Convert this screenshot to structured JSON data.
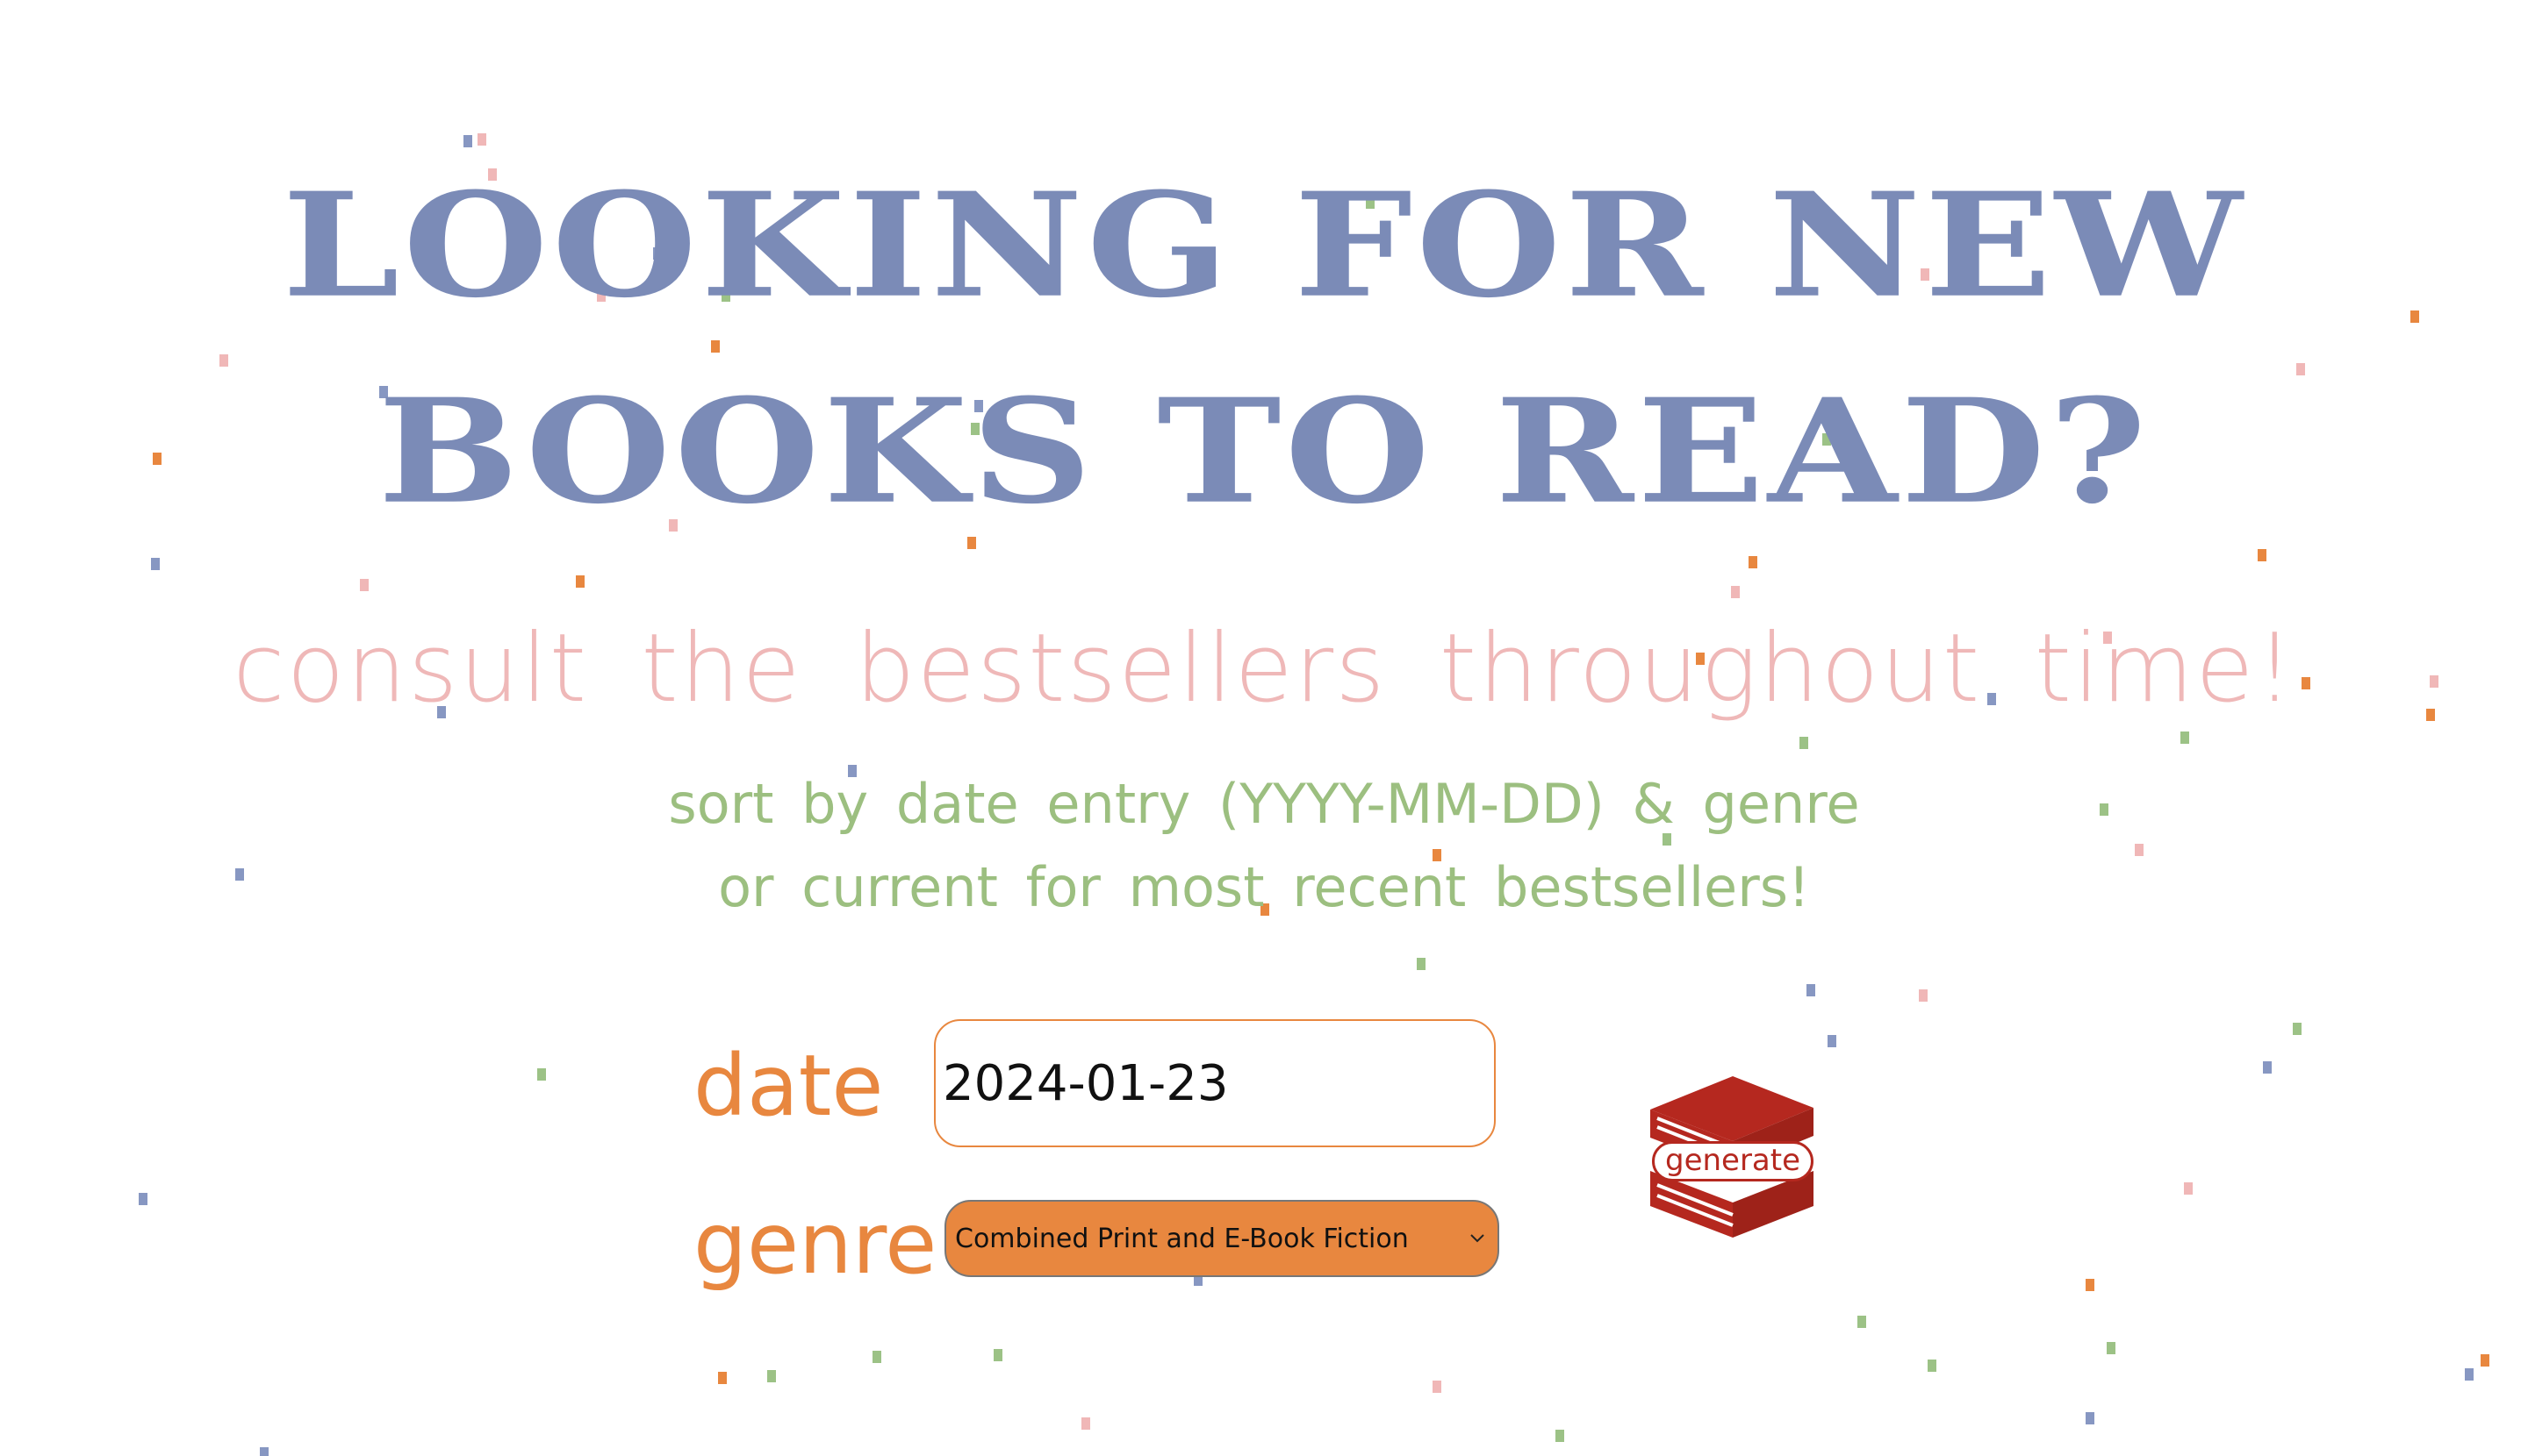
{
  "header": {
    "line1": "LOOKING FOR NEW",
    "line2": "BOOKS TO READ?",
    "subtitle": "consult the bestsellers throughout time!",
    "instructions_line1": "sort by date entry (YYYY-MM-DD) & genre",
    "instructions_line2": "or current for most recent bestsellers!"
  },
  "form": {
    "date_label": "date",
    "date_value": "2024-01-23",
    "genre_label": "genre",
    "genre_selected": "Combined Print and E-Book Fiction",
    "generate_label": "generate"
  },
  "icons": {
    "dropdown": "chevron-down-icon",
    "generate": "book-stack-icon",
    "confetti": "book-icon"
  },
  "colors": {
    "headline": "#7b8bb7",
    "subtitle": "#efb8b8",
    "instructions": "#9cbf80",
    "accent_orange": "#e8873f",
    "button_red": "#b5281f"
  }
}
